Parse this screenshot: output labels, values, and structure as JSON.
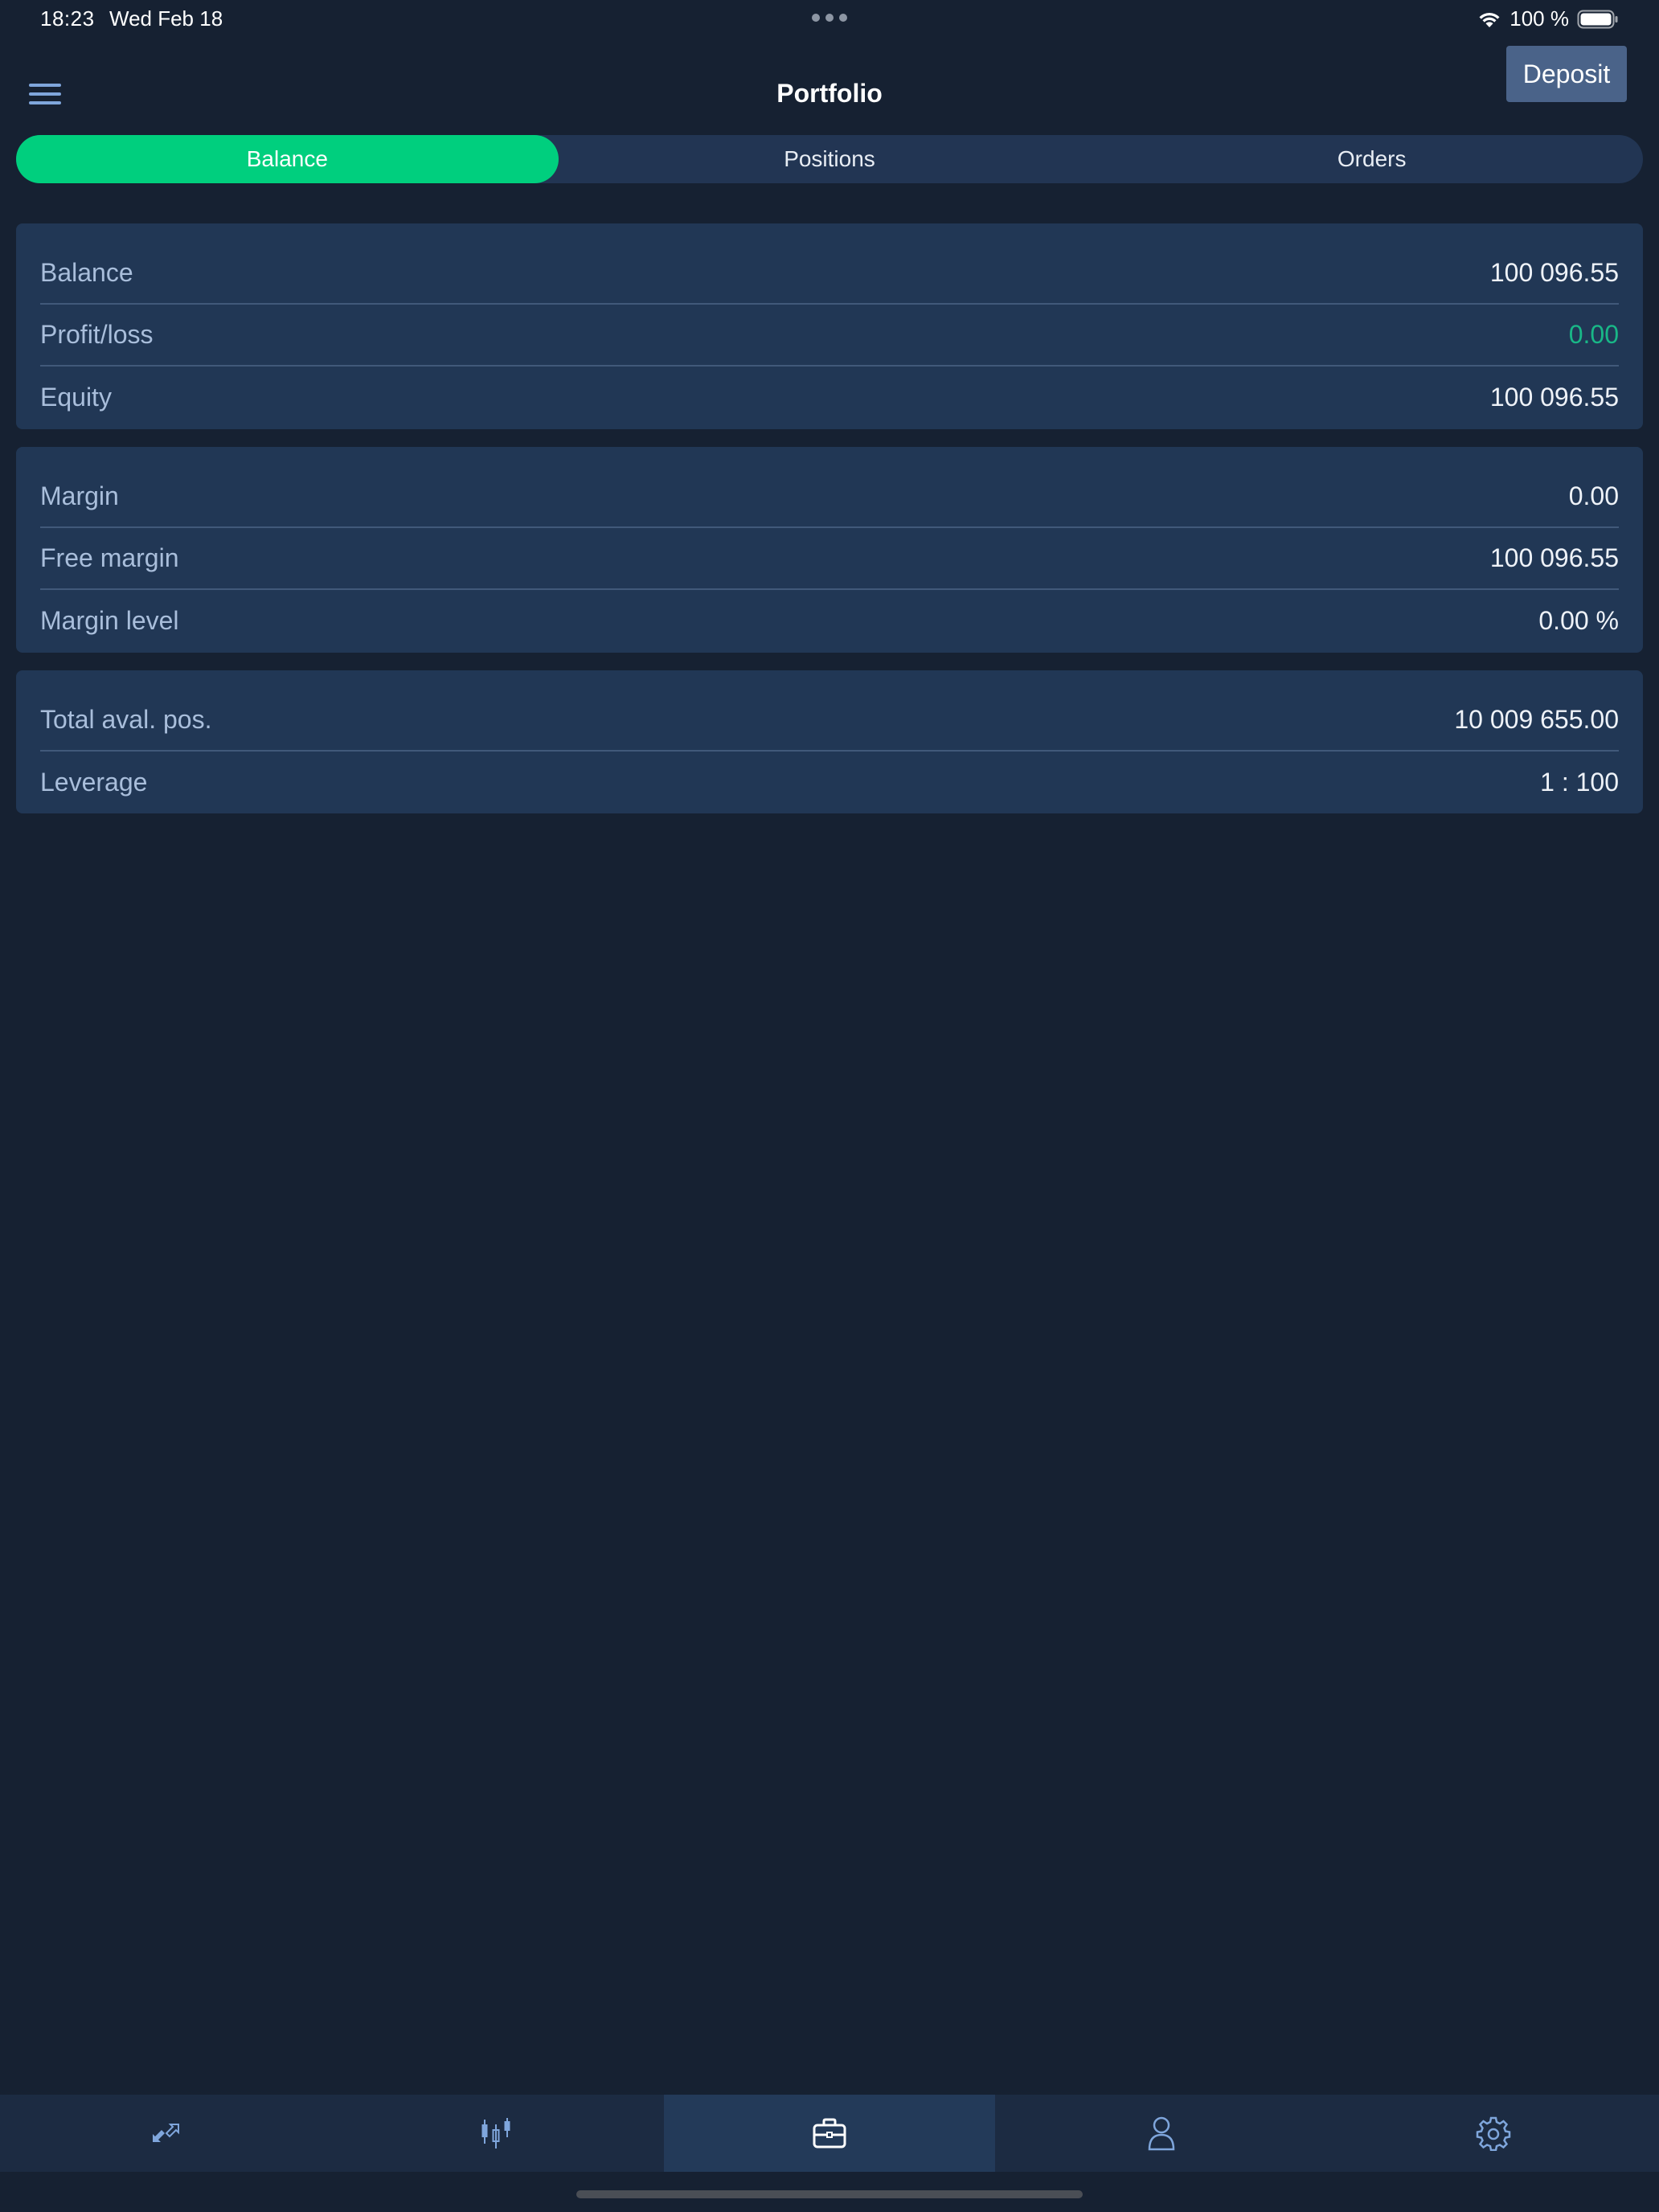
{
  "status_bar": {
    "time": "18:23",
    "date": "Wed Feb 18",
    "battery": "100 %"
  },
  "header": {
    "title": "Portfolio",
    "deposit_label": "Deposit",
    "menu_icon": "hamburger-menu-icon"
  },
  "tabs": [
    {
      "label": "Balance",
      "active": true
    },
    {
      "label": "Positions",
      "active": false
    },
    {
      "label": "Orders",
      "active": false
    }
  ],
  "cards": [
    {
      "rows": [
        {
          "label": "Balance",
          "value": "100 096.55"
        },
        {
          "label": "Profit/loss",
          "value": "0.00"
        },
        {
          "label": "Equity",
          "value": "100 096.55"
        }
      ]
    },
    {
      "rows": [
        {
          "label": "Margin",
          "value": "0.00"
        },
        {
          "label": "Free margin",
          "value": "100 096.55"
        },
        {
          "label": "Margin level",
          "value": "0.00 %"
        }
      ]
    },
    {
      "rows": [
        {
          "label": "Total aval. pos.",
          "value": "10 009 655.00"
        },
        {
          "label": "Leverage",
          "value": "1 : 100"
        }
      ]
    }
  ],
  "bottom_nav": [
    {
      "icon": "trade-arrows-icon",
      "active": false
    },
    {
      "icon": "candlestick-chart-icon",
      "active": false
    },
    {
      "icon": "briefcase-icon",
      "active": true
    },
    {
      "icon": "user-icon",
      "active": false
    },
    {
      "icon": "gear-icon",
      "active": false
    }
  ],
  "colors": {
    "background": "#162132",
    "card": "#213755",
    "accent_green": "#00cf7e",
    "profit_green": "#19b787",
    "deposit_button": "#4a6389"
  }
}
